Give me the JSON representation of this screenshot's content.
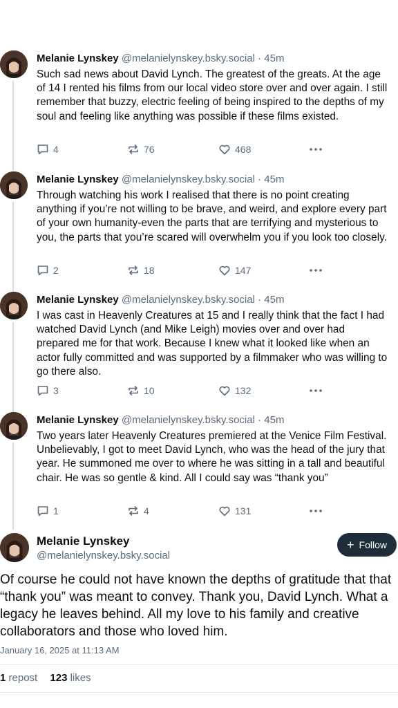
{
  "thread": [
    {
      "name": "Melanie Lynskey",
      "handle": "@melanielynskey.bsky.social",
      "time": "· 45m",
      "text": "Such sad news about David Lynch. The greatest of the greats. At the age of 14 I rented his films from our local video store over and over again. I still remember that buzzy, electric feeling of being inspired to the depths of my soul and feeling like anything was possible if these films existed.",
      "replies": "4",
      "reposts": "76",
      "likes": "468"
    },
    {
      "name": "Melanie Lynskey",
      "handle": "@melanielynskey.bsky.social",
      "time": "· 45m",
      "text": "Through watching his work I realised that there is no point creating anything if you’re not willing to be brave, and weird, and explore every part of your own humanity-even the parts that are terrifying and mysterious to you, the parts that you’re scared will overwhelm you if you look too closely.",
      "replies": "2",
      "reposts": "18",
      "likes": "147"
    },
    {
      "name": "Melanie Lynskey",
      "handle": "@melanielynskey.bsky.social",
      "time": "· 45m",
      "text": "I was cast in Heavenly Creatures at 15 and I really think that the fact I had watched David Lynch (and Mike Leigh) movies over and over had prepared me for that work. Because I knew what it looked like when an actor fully committed and was supported by a filmmaker who was willing to go there also.",
      "replies": "3",
      "reposts": "10",
      "likes": "132"
    },
    {
      "name": "Melanie Lynskey",
      "handle": "@melanielynskey.bsky.social",
      "time": "· 45m",
      "text": "Two years later Heavenly Creatures premiered at the Venice Film Festival. Unbelievably, I got to meet David Lynch, who was the head of the jury that year. He summoned me over to where he was sitting in a tall and beautiful chair. He was so gentle & kind. All I could say was “thank you”",
      "replies": "1",
      "reposts": "4",
      "likes": "131"
    }
  ],
  "main_post": {
    "name": "Melanie Lynskey",
    "handle": "@melanielynskey.bsky.social",
    "follow_label": "Follow",
    "text": "Of course he could not have known the depths of gratitude that that “thank you” was meant to convey. Thank you, David Lynch. What a legacy he leaves behind. All my love to his family and creative collaborators and those who loved him.",
    "timestamp": "January 16, 2025 at 11:13 AM",
    "repost_count": "1",
    "repost_label": "repost",
    "like_count": "123",
    "like_label": "likes"
  },
  "colors": {
    "text": "#0b0f14",
    "muted": "#5b6b7b",
    "follow_bg": "#1f2d3a",
    "thread_line": "#d6dbe0"
  },
  "icons": [
    "reply-icon",
    "repost-icon",
    "like-icon",
    "more-icon",
    "plus-icon"
  ]
}
